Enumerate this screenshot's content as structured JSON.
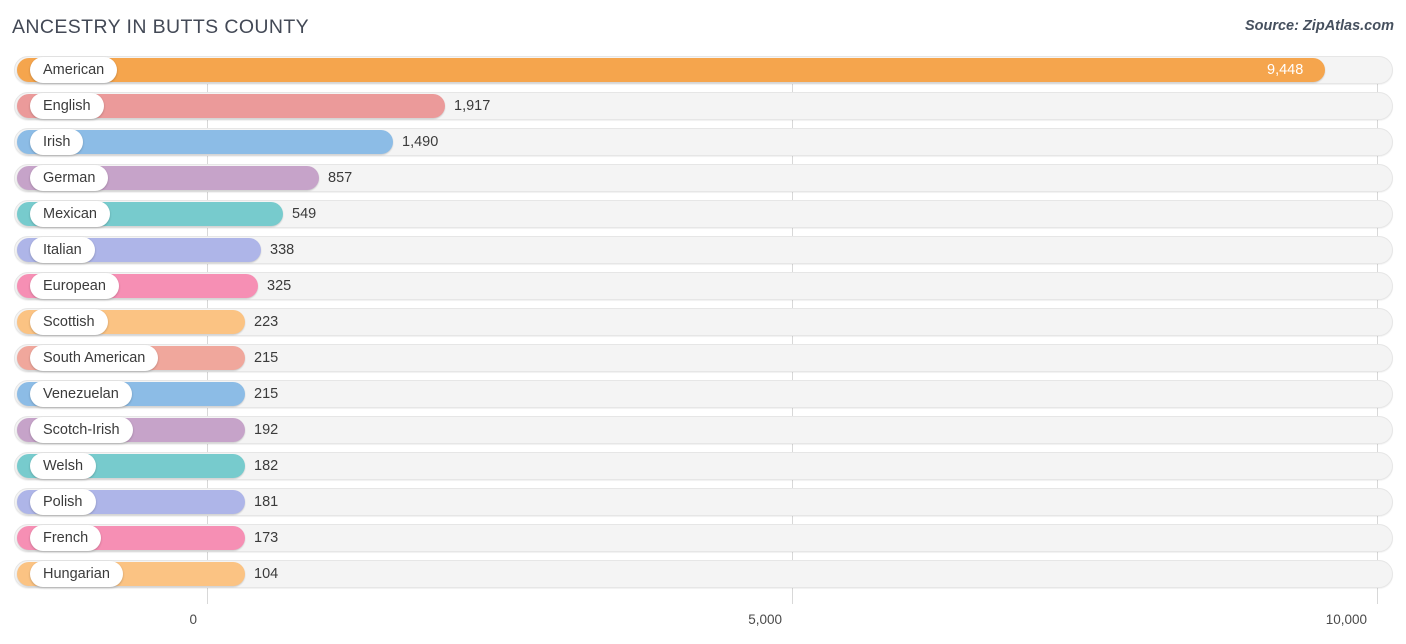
{
  "header": {
    "title": "ANCESTRY IN BUTTS COUNTY",
    "source": "Source: ZipAtlas.com"
  },
  "axis": {
    "ticks": [
      "0",
      "5,000",
      "10,000"
    ],
    "tick_values": [
      0,
      5000,
      10000
    ]
  },
  "colors": {
    "orange": "#f5a54d",
    "salmon": "#eb9a9a",
    "blue": "#8cbce6",
    "purple": "#c6a3c9",
    "teal": "#77cbcd",
    "periwinkle": "#aeb5e8",
    "pink": "#f68fb4",
    "track": "#f4f4f4",
    "gridline": "#d8d8d8"
  },
  "chart_data": {
    "type": "bar",
    "title": "ANCESTRY IN BUTTS COUNTY",
    "orientation": "horizontal",
    "xlabel": "",
    "ylabel": "",
    "xlim": [
      0,
      10000
    ],
    "grid": true,
    "legend": false,
    "categories": [
      "American",
      "English",
      "Irish",
      "German",
      "Mexican",
      "Italian",
      "European",
      "Scottish",
      "South American",
      "Venezuelan",
      "Scotch-Irish",
      "Welsh",
      "Polish",
      "French",
      "Hungarian"
    ],
    "values": [
      9448,
      1917,
      1490,
      857,
      549,
      338,
      325,
      223,
      215,
      215,
      192,
      182,
      181,
      173,
      104
    ],
    "value_labels": [
      "9,448",
      "1,917",
      "1,490",
      "857",
      "549",
      "338",
      "325",
      "223",
      "215",
      "215",
      "192",
      "182",
      "181",
      "173",
      "104"
    ]
  },
  "rows": [
    {
      "label": "American",
      "value": 9448,
      "value_label": "9,448",
      "color": "#f5a54d",
      "bar_end": 1325,
      "label_inside": true
    },
    {
      "label": "English",
      "value": 1917,
      "value_label": "1,917",
      "color": "#eb9a9a",
      "bar_end": 445,
      "label_inside": false
    },
    {
      "label": "Irish",
      "value": 1490,
      "value_label": "1,490",
      "color": "#8cbce6",
      "bar_end": 393,
      "label_inside": false
    },
    {
      "label": "German",
      "value": 857,
      "value_label": "857",
      "color": "#c6a3c9",
      "bar_end": 319,
      "label_inside": false
    },
    {
      "label": "Mexican",
      "value": 549,
      "value_label": "549",
      "color": "#77cbcd",
      "bar_end": 283,
      "label_inside": false
    },
    {
      "label": "Italian",
      "value": 338,
      "value_label": "338",
      "color": "#aeb5e8",
      "bar_end": 261,
      "label_inside": false
    },
    {
      "label": "European",
      "value": 325,
      "value_label": "325",
      "color": "#f68fb4",
      "bar_end": 258,
      "label_inside": false
    },
    {
      "label": "Scottish",
      "value": 223,
      "value_label": "223",
      "color": "#fbc383",
      "bar_end": 245,
      "label_inside": false
    },
    {
      "label": "South American",
      "value": 215,
      "value_label": "215",
      "color": "#f0a79c",
      "bar_end": 245,
      "label_inside": false
    },
    {
      "label": "Venezuelan",
      "value": 215,
      "value_label": "215",
      "color": "#8cbce6",
      "bar_end": 245,
      "label_inside": false
    },
    {
      "label": "Scotch-Irish",
      "value": 192,
      "value_label": "192",
      "color": "#c6a3c9",
      "bar_end": 245,
      "label_inside": false
    },
    {
      "label": "Welsh",
      "value": 182,
      "value_label": "182",
      "color": "#77cbcd",
      "bar_end": 245,
      "label_inside": false
    },
    {
      "label": "Polish",
      "value": 181,
      "value_label": "181",
      "color": "#aeb5e8",
      "bar_end": 245,
      "label_inside": false
    },
    {
      "label": "French",
      "value": 173,
      "value_label": "173",
      "color": "#f68fb4",
      "bar_end": 245,
      "label_inside": false
    },
    {
      "label": "Hungarian",
      "value": 104,
      "value_label": "104",
      "color": "#fbc383",
      "bar_end": 245,
      "label_inside": false
    }
  ]
}
